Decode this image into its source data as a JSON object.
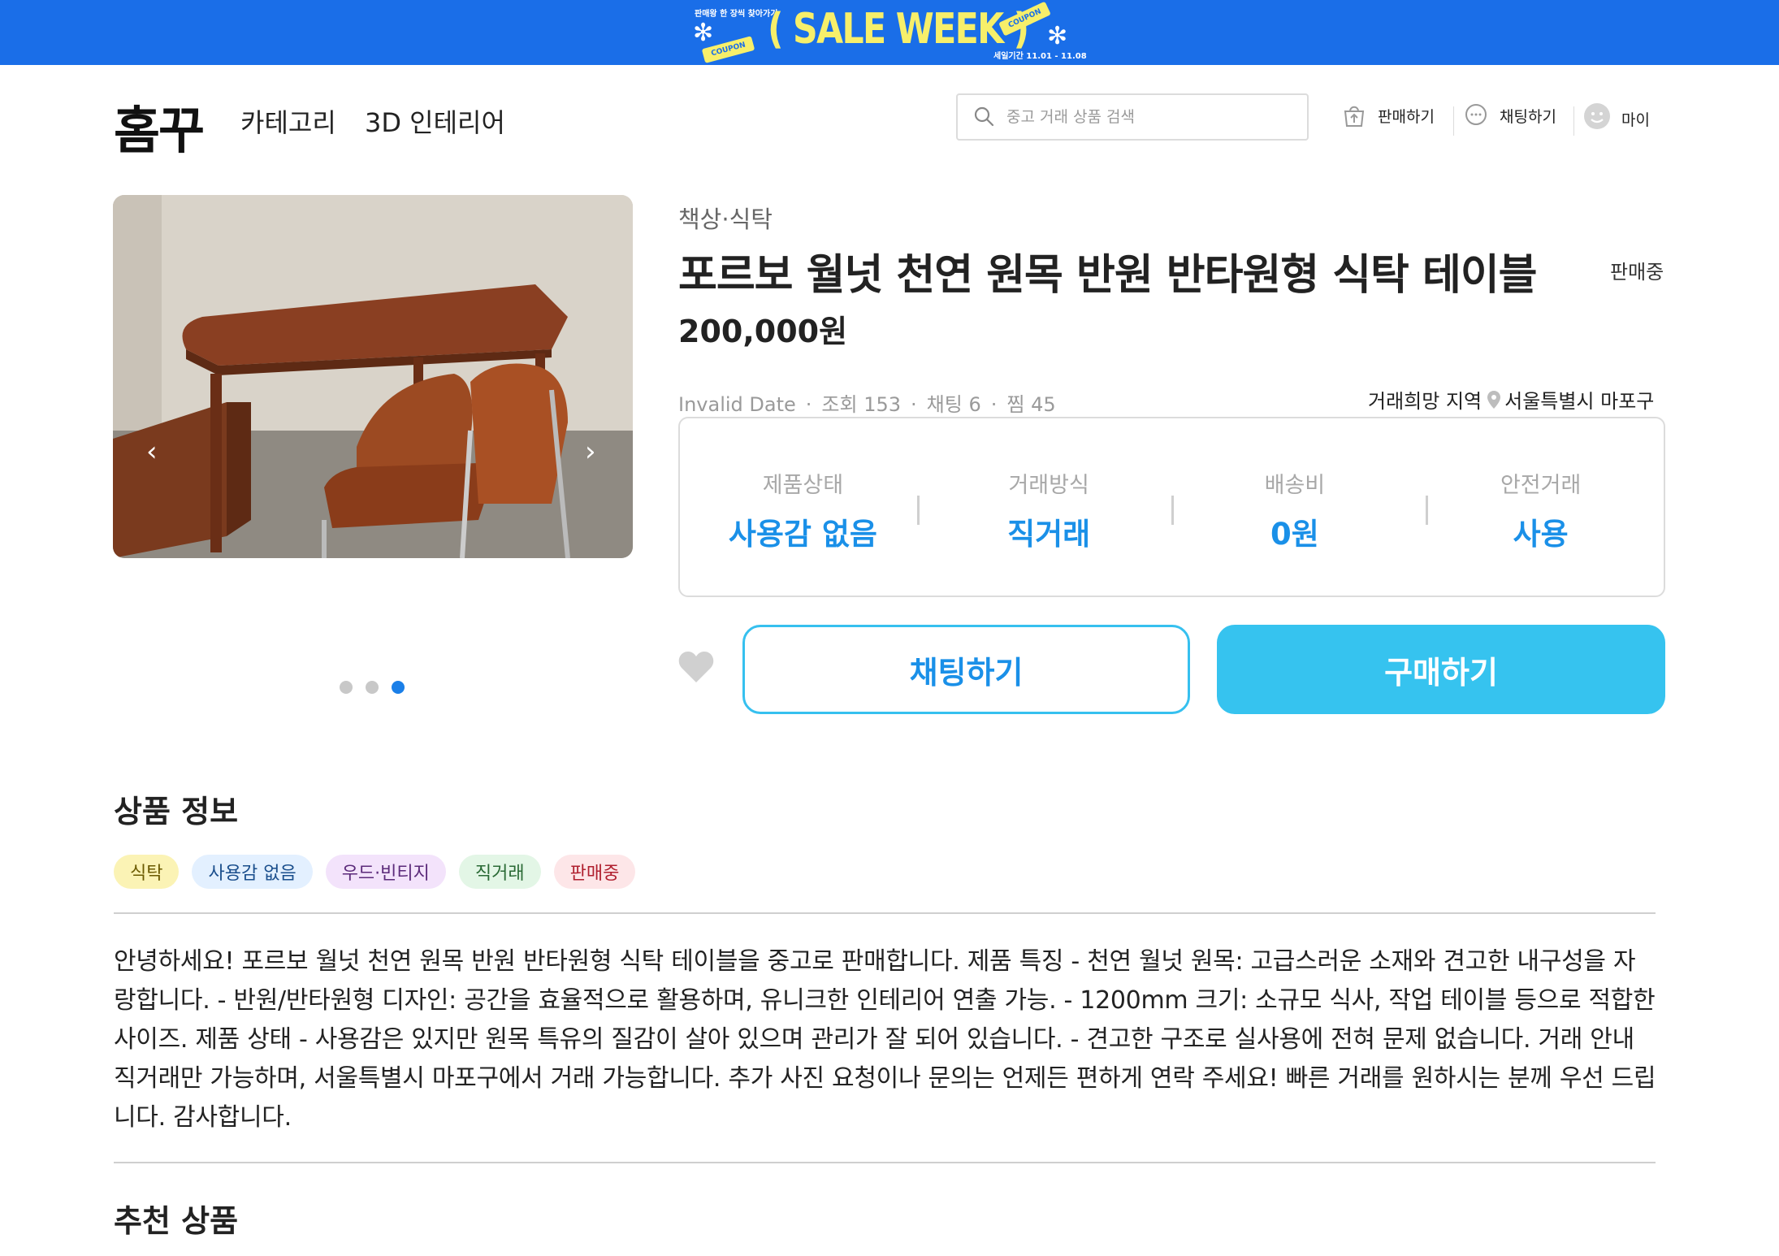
{
  "banner": {
    "title": "( SALE WEEK )",
    "small_top": "판매왕 한 장씩 찾아가기",
    "period": "세일기간 11.01 - 11.08",
    "coupon1": "COUPON",
    "coupon2": "COUPON",
    "colors": {
      "background": "#1a6ee8",
      "title": "#f7ef6a"
    }
  },
  "header": {
    "logo": "홈꾸",
    "nav": {
      "category": "카테고리",
      "interior3d": "3D 인테리어"
    },
    "search": {
      "placeholder": "중고 거래 상품 검색",
      "icon": "search-icon"
    },
    "links": {
      "sell": "판매하기",
      "chat": "채팅하기",
      "my": "마이"
    }
  },
  "product": {
    "category": "책상·식탁",
    "title": "포르보 월넛 천연 원목 반원 반타원형 식탁 테이블",
    "status": "판매중",
    "price": "200,000원",
    "meta": {
      "date": "Invalid Date",
      "views": "조회 153",
      "chats": "채팅 6",
      "likes": "찜 45"
    },
    "location_label": "거래희망 지역",
    "location": "서울특별시 마포구",
    "image_carousel": {
      "total": 3,
      "active_index": 3
    },
    "specs": [
      {
        "label": "제품상태",
        "value": "사용감 없음"
      },
      {
        "label": "거래방식",
        "value": "직거래"
      },
      {
        "label": "배송비",
        "value": "0원"
      },
      {
        "label": "안전거래",
        "value": "사용"
      }
    ],
    "buttons": {
      "chat": "채팅하기",
      "buy": "구매하기"
    },
    "accent_color": "#1a90e8"
  },
  "details": {
    "section_title": "상품 정보",
    "tags": [
      {
        "label": "식탁",
        "bg": "#fbf3b5",
        "color": "#6b5a00"
      },
      {
        "label": "사용감 없음",
        "bg": "#e3f0ff",
        "color": "#1a4e8c"
      },
      {
        "label": "우드·빈티지",
        "bg": "#f3e3fb",
        "color": "#5b2a7a"
      },
      {
        "label": "직거래",
        "bg": "#e3f6e6",
        "color": "#2a6a35"
      },
      {
        "label": "판매중",
        "bg": "#fde6e8",
        "color": "#b0202f"
      }
    ],
    "description": "안녕하세요! 포르보 월넛 천연 원목 반원 반타원형 식탁 테이블을 중고로 판매합니다. 제품 특징 - 천연 월넛 원목: 고급스러운 소재와 견고한 내구성을 자랑합니다. - 반원/반타원형 디자인: 공간을 효율적으로 활용하며, 유니크한 인테리어 연출 가능. - 1200mm 크기: 소규모 식사, 작업 테이블 등으로 적합한 사이즈. 제품 상태 - 사용감은 있지만 원목 특유의 질감이 살아 있으며 관리가 잘 되어 있습니다. - 견고한 구조로 실사용에 전혀 문제 없습니다. 거래 안내 직거래만 가능하며, 서울특별시 마포구에서 거래 가능합니다. 추가 사진 요청이나 문의는 언제든 편하게 연락 주세요! 빠른 거래를 원하시는 분께 우선 드립니다. 감사합니다."
  },
  "recommend": {
    "section_title": "추천 상품"
  }
}
